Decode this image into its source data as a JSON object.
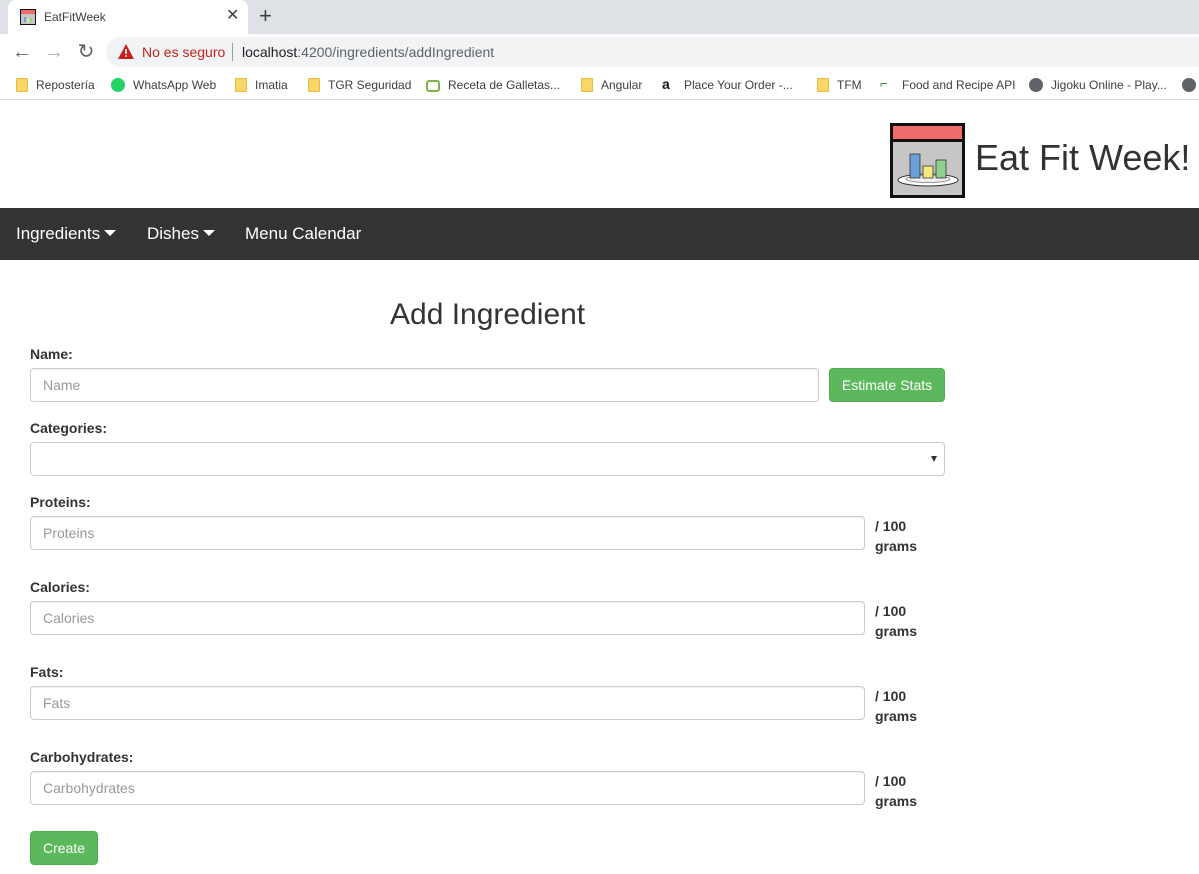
{
  "browser": {
    "tab_title": "EatFitWeek",
    "new_tab_symbol": "+",
    "close_symbol": "✕",
    "security_label": "No es seguro",
    "url_host": "localhost",
    "url_path": ":4200/ingredients/addIngredient"
  },
  "bookmarks": [
    {
      "label": "Repostería",
      "icon": "folder-icon"
    },
    {
      "label": "WhatsApp Web",
      "icon": "whatsapp-icon"
    },
    {
      "label": "Imatia",
      "icon": "folder-icon"
    },
    {
      "label": "TGR Seguridad",
      "icon": "folder-icon"
    },
    {
      "label": "Receta de Galletas...",
      "icon": "tv-icon"
    },
    {
      "label": "Angular",
      "icon": "folder-icon"
    },
    {
      "label": "Place Your Order -...",
      "icon": "amazon-icon"
    },
    {
      "label": "TFM",
      "icon": "folder-icon"
    },
    {
      "label": "Food and Recipe API",
      "icon": "food-api-icon"
    },
    {
      "label": "Jigoku Online - Play...",
      "icon": "globe-icon"
    }
  ],
  "app": {
    "brand": "Eat Fit Week!"
  },
  "navbar": {
    "ingredients": "Ingredients",
    "dishes": "Dishes",
    "menu_calendar": "Menu Calendar"
  },
  "form": {
    "title": "Add Ingredient",
    "name_label": "Name:",
    "name_placeholder": "Name",
    "name_value": "",
    "estimate_button": "Estimate Stats",
    "categories_label": "Categories:",
    "categories_value": "",
    "proteins_label": "Proteins:",
    "proteins_placeholder": "Proteins",
    "calories_label": "Calories:",
    "calories_placeholder": "Calories",
    "fats_label": "Fats:",
    "fats_placeholder": "Fats",
    "carbs_label": "Carbohydrates:",
    "carbs_placeholder": "Carbohydrates",
    "unit_line1": "/ 100",
    "unit_line2": "grams",
    "create_button": "Create"
  },
  "colors": {
    "navbar": "#333333",
    "button_green": "#5cb85c",
    "logo_bar": "#f06b6b",
    "warning_red": "#c5221f"
  }
}
